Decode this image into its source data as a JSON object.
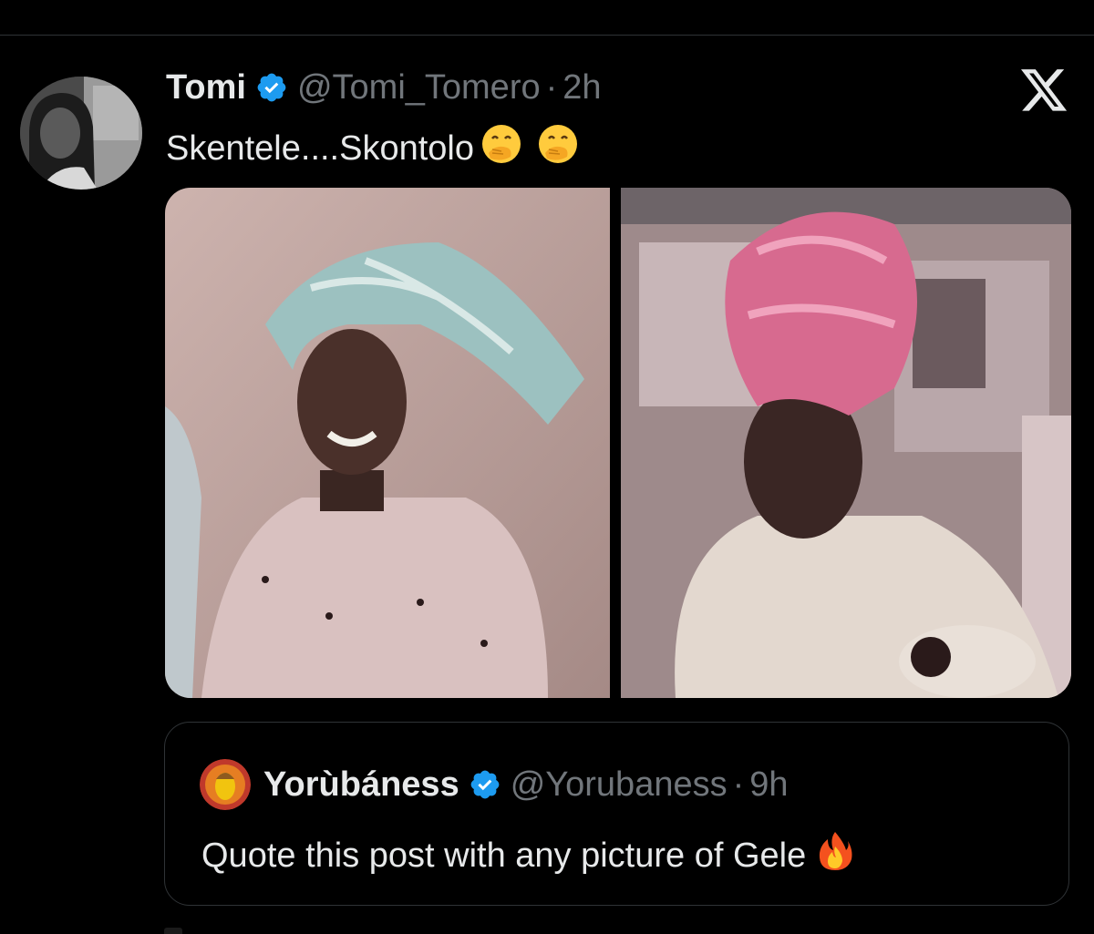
{
  "colors": {
    "background": "#000000",
    "text": "#e7e9ea",
    "muted": "#71767b",
    "verified": "#1d9bf0",
    "border": "#2f3336"
  },
  "tweet": {
    "author_name": "Tomi",
    "author_handle": "@Tomi_Tomero",
    "separator": "·",
    "timestamp": "2h",
    "text": "Skentele....Skontolo",
    "emojis": [
      "hand-over-mouth-emoji",
      "hand-over-mouth-emoji"
    ],
    "verified_icon": "verified-badge-icon",
    "close_icon": "x-logo-icon",
    "media": [
      {
        "kind": "photo",
        "icon": "photo-girl-with-blue-gele"
      },
      {
        "kind": "photo",
        "icon": "photo-woman-with-pink-gele"
      }
    ]
  },
  "quoted_tweet": {
    "author_name": "Yorùbáness",
    "author_handle": "@Yorubaness",
    "separator": "·",
    "timestamp": "9h",
    "text": "Quote this post with any picture of Gele",
    "emoji": "fire-emoji",
    "verified_icon": "verified-badge-icon"
  }
}
